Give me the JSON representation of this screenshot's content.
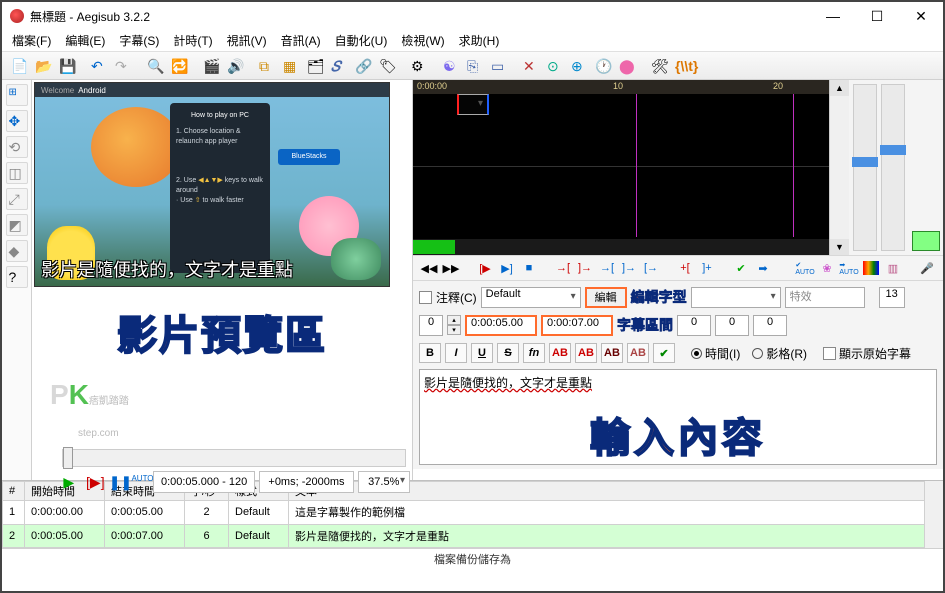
{
  "window": {
    "title": "無標題 - Aegisub 3.2.2",
    "min": "—",
    "max": "☐",
    "close": "✕"
  },
  "menu": [
    "檔案(F)",
    "編輯(E)",
    "字幕(S)",
    "計時(T)",
    "視訊(V)",
    "音訊(A)",
    "自動化(U)",
    "檢視(W)",
    "求助(H)"
  ],
  "waveform": {
    "ticks": [
      {
        "label": "0:00:00",
        "pos": 4
      },
      {
        "label": "10",
        "pos": 200
      },
      {
        "label": "20",
        "pos": 360
      }
    ]
  },
  "video": {
    "tabs": [
      "Welcome",
      "Android"
    ],
    "phone_title": "How to play on PC",
    "phone_lines": [
      "1. Choose location & relaunch app player",
      "2. Use",
      "keys to walk around",
      "· Use",
      "to walk faster"
    ],
    "bluestacks": "BlueStacks",
    "caption": "影片是隨便找的，文字才是重點",
    "preview_label": "影片預覽區",
    "pk_small": "痞凱踏踏",
    "pk_step": "step.com",
    "timecode": "0:00:05.000 - 120",
    "offset": "+0ms; -2000ms",
    "zoom": "37.5%"
  },
  "edit": {
    "comment_label": "注釋(C)",
    "style": "Default",
    "edit_btn": "編輯",
    "annot_font": "編輯字型",
    "effect_ph": "特效",
    "chars": "13",
    "layer": "0",
    "start": "0:00:05.00",
    "end": "0:00:07.00",
    "annot_range": "字幕區間",
    "m1": "0",
    "m2": "0",
    "m3": "0",
    "time_radio": "時間(I)",
    "frame_radio": "影格(R)",
    "show_orig": "顯示原始字幕",
    "text": "影片是隨便找的，文字才是重點",
    "big_annot": "輸入內容"
  },
  "grid": {
    "headers": [
      "#",
      "開始時間",
      "結束時間",
      "字/秒",
      "樣式",
      "文本"
    ],
    "rows": [
      {
        "n": "1",
        "s": "0:00:00.00",
        "e": "0:00:05.00",
        "cps": "2",
        "sty": "Default",
        "txt": "這是字幕製作的範例檔",
        "sel": false
      },
      {
        "n": "2",
        "s": "0:00:05.00",
        "e": "0:00:07.00",
        "cps": "6",
        "sty": "Default",
        "txt": "影片是隨便找的，文字才是重點",
        "sel": true
      }
    ]
  },
  "status": "檔案備份儲存為"
}
